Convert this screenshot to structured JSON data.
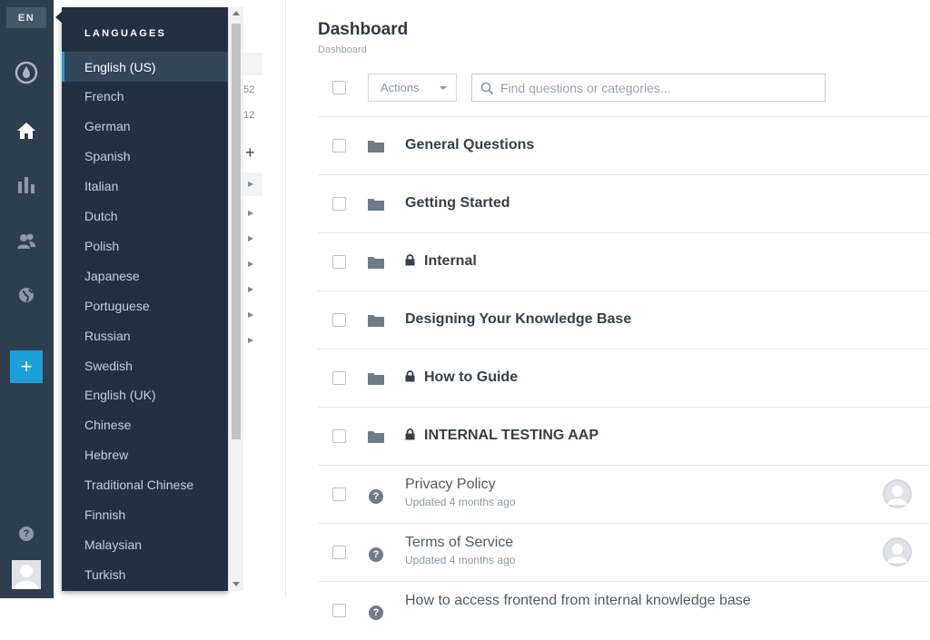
{
  "language_button": "EN",
  "dropdown": {
    "header": "LANGUAGES",
    "selected": "English (US)",
    "languages": [
      "English (US)",
      "French",
      "German",
      "Spanish",
      "Italian",
      "Dutch",
      "Polish",
      "Japanese",
      "Portuguese",
      "Russian",
      "Swedish",
      "English (UK)",
      "Chinese",
      "Hebrew",
      "Traditional Chinese",
      "Finnish",
      "Malaysian",
      "Turkish"
    ]
  },
  "rail": {
    "icons": [
      "logo-icon",
      "home-icon",
      "chart-icon",
      "users-icon",
      "globe-icon"
    ],
    "add_label": "+",
    "help_label": "?"
  },
  "secondary_panel": {
    "counts": [
      "52",
      "12"
    ],
    "add_label": "+"
  },
  "main": {
    "title": "Dashboard",
    "breadcrumb": "Dashboard",
    "actions_label": "Actions",
    "search_placeholder": "Find questions or categories..."
  },
  "rows": [
    {
      "type": "category",
      "title": "General Questions",
      "locked": false
    },
    {
      "type": "category",
      "title": "Getting Started",
      "locked": false
    },
    {
      "type": "category",
      "title": "Internal",
      "locked": true
    },
    {
      "type": "category",
      "title": "Designing Your Knowledge Base",
      "locked": false
    },
    {
      "type": "category",
      "title": "How to Guide",
      "locked": true
    },
    {
      "type": "category",
      "title": "INTERNAL TESTING AAP",
      "locked": true
    },
    {
      "type": "article",
      "title": "Privacy Policy",
      "updated": "Updated 4 months ago"
    },
    {
      "type": "article",
      "title": "Terms of Service",
      "updated": "Updated 4 months ago"
    },
    {
      "type": "article",
      "title": "How to access frontend from internal knowledge base",
      "updated": ""
    }
  ],
  "colors": {
    "rail": "#2e3e4e",
    "dropdown": "#223042",
    "accent": "#1a9fd8"
  }
}
